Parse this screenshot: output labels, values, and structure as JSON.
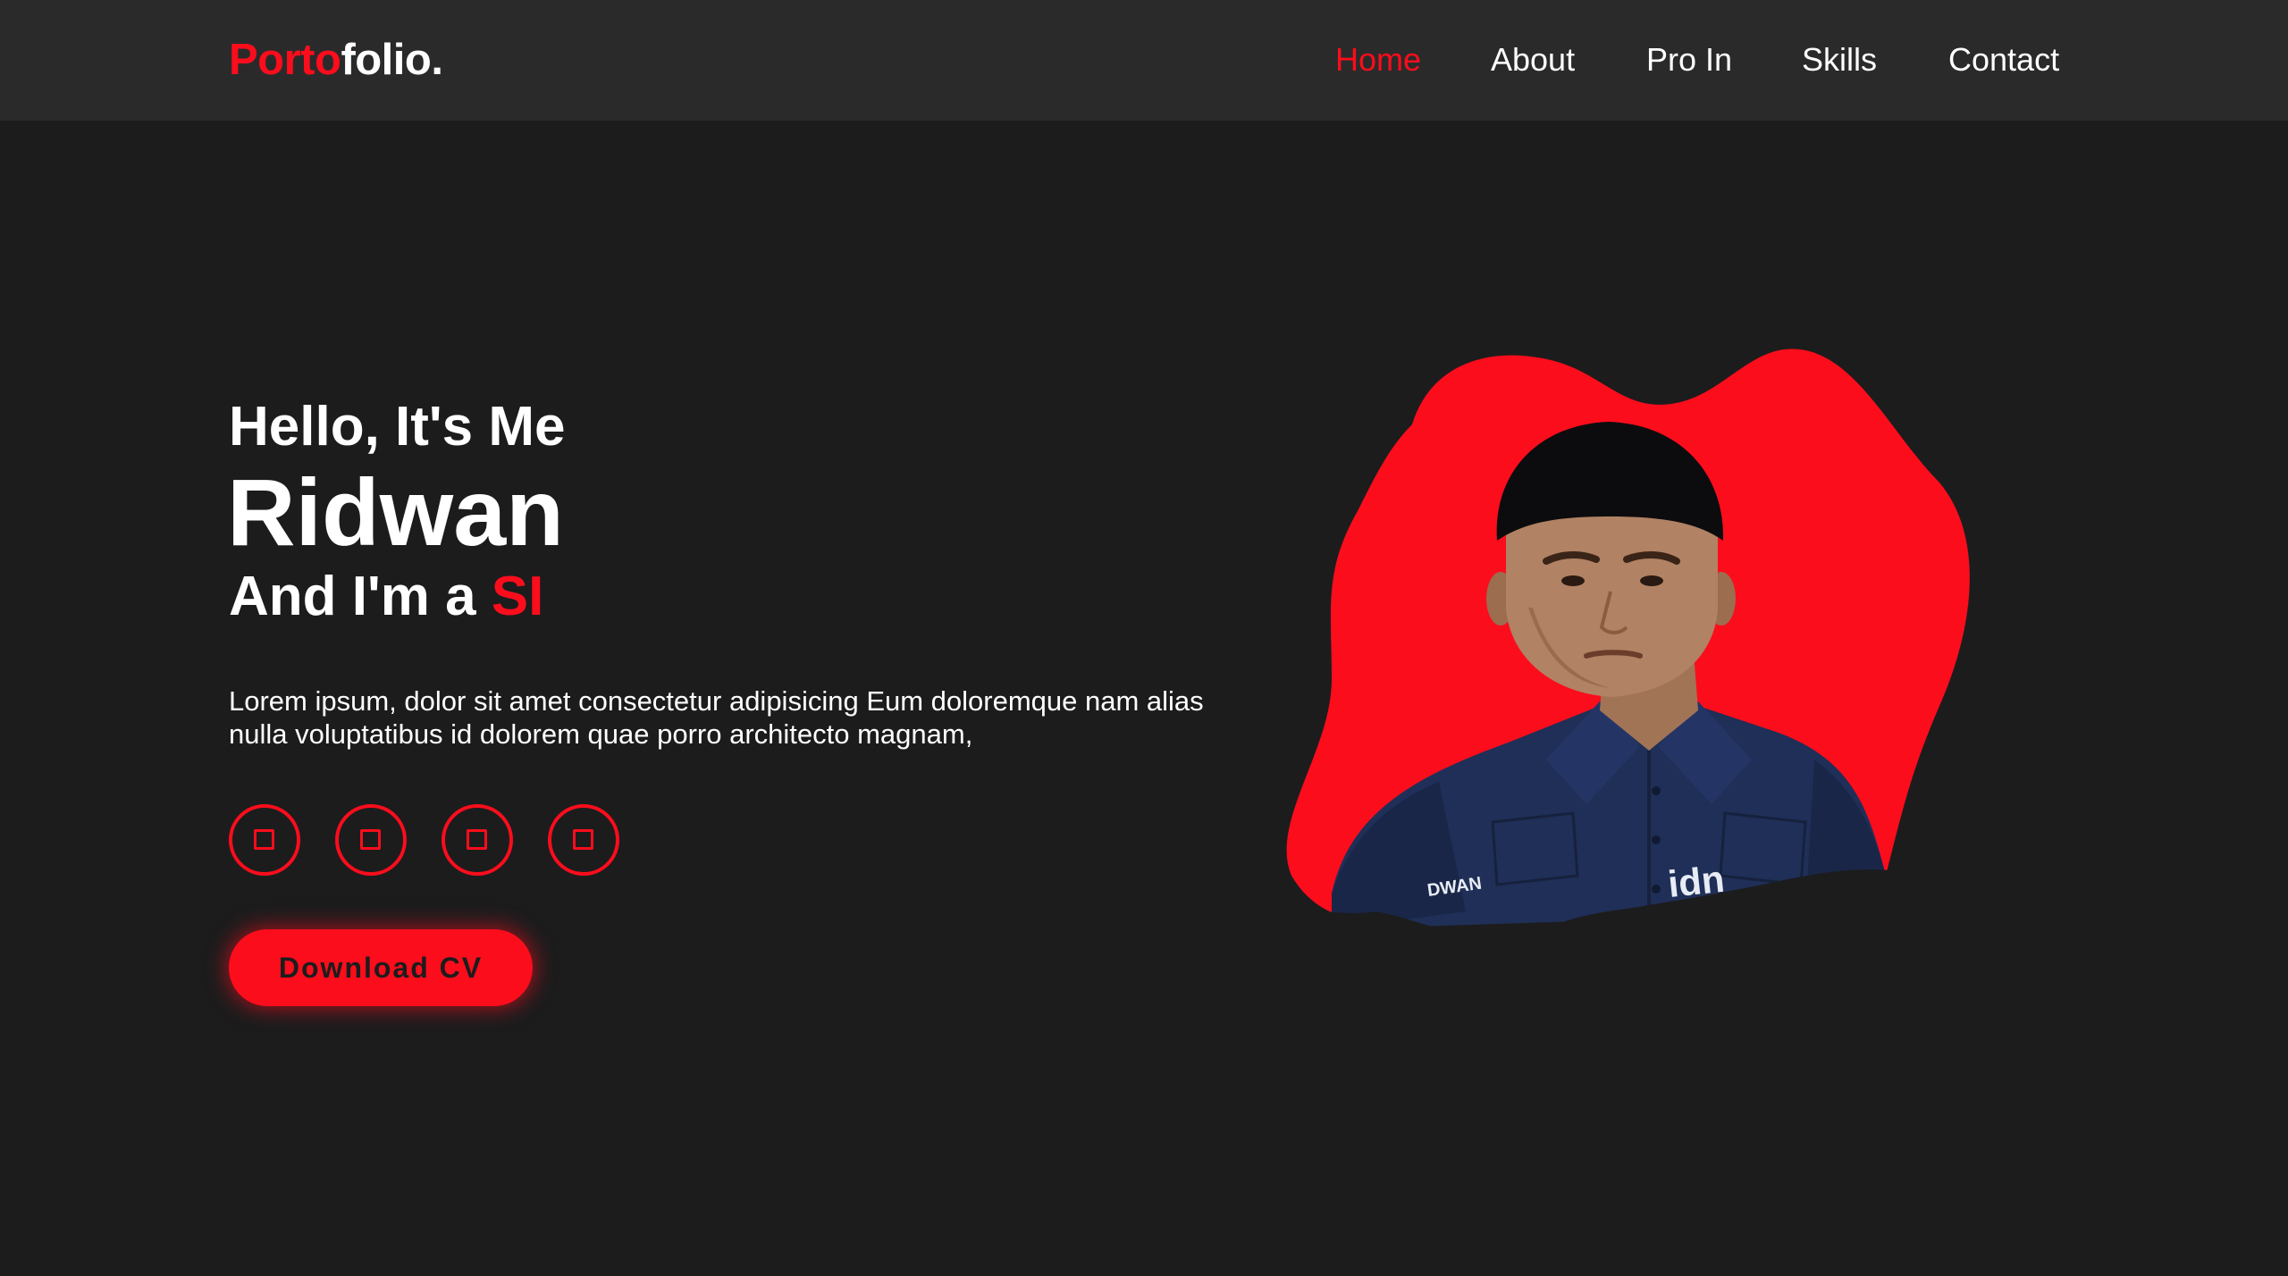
{
  "header": {
    "logo_accent": "Porto",
    "logo_rest": "folio."
  },
  "nav": {
    "items": [
      {
        "label": "Home",
        "active": true
      },
      {
        "label": "About",
        "active": false
      },
      {
        "label": "Pro In",
        "active": false
      },
      {
        "label": "Skills",
        "active": false
      },
      {
        "label": "Contact",
        "active": false
      }
    ]
  },
  "hero": {
    "greeting": "Hello, It's Me",
    "name": "Ridwan",
    "role_prefix": "And I'm a ",
    "role_accent": "SI",
    "description": "Lorem ipsum, dolor sit amet consectetur adipisicing Eum doloremque nam alias nulla voluptatibus id dolorem quae porro architecto magnam,",
    "social_icons": [
      "social-icon-1",
      "social-icon-2",
      "social-icon-3",
      "social-icon-4"
    ],
    "cv_button": "Download CV"
  },
  "portrait": {
    "shirt_name": "DWAN",
    "shirt_logo": "idn"
  },
  "colors": {
    "accent": "#fb0d1c",
    "background": "#1c1c1d",
    "header_bg": "#2a2a2b",
    "text": "#ffffff"
  }
}
